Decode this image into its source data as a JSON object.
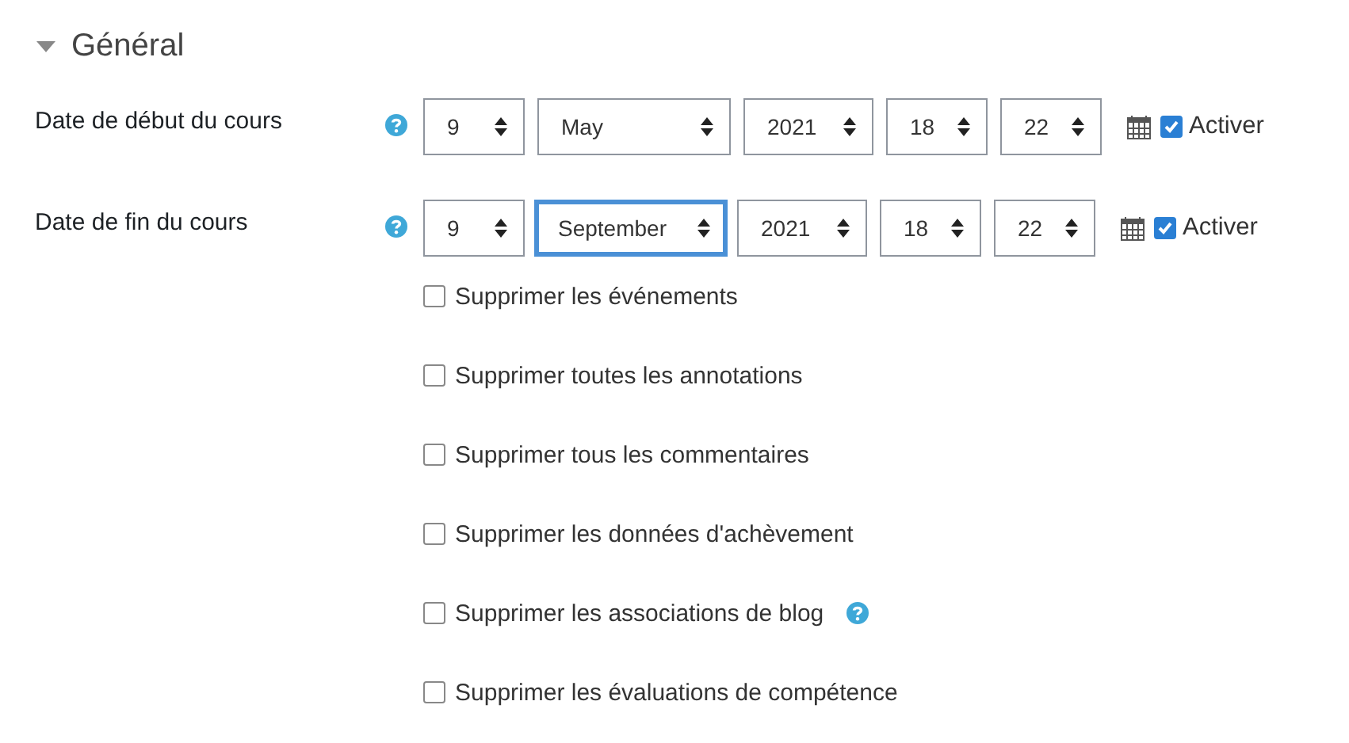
{
  "section": {
    "title": "Général",
    "expanded": true
  },
  "date_rows": [
    {
      "label": "Date de début du cours",
      "help": true,
      "fields": [
        {
          "value": "9",
          "focused": false
        },
        {
          "value": "May",
          "focused": false
        },
        {
          "value": "2021",
          "focused": false
        },
        {
          "value": "18",
          "focused": false
        },
        {
          "value": "22",
          "focused": false
        }
      ],
      "enable": {
        "label": "Activer",
        "checked": true
      }
    },
    {
      "label": "Date de fin du cours",
      "help": true,
      "fields": [
        {
          "value": "9",
          "focused": false
        },
        {
          "value": "September",
          "focused": true
        },
        {
          "value": "2021",
          "focused": false
        },
        {
          "value": "18",
          "focused": false
        },
        {
          "value": "22",
          "focused": false
        }
      ],
      "enable": {
        "label": "Activer",
        "checked": true
      }
    }
  ],
  "options": [
    {
      "label": "Supprimer les événements",
      "checked": false,
      "help": false
    },
    {
      "label": "Supprimer toutes les annotations",
      "checked": false,
      "help": false
    },
    {
      "label": "Supprimer tous les commentaires",
      "checked": false,
      "help": false
    },
    {
      "label": "Supprimer les données d'achèvement",
      "checked": false,
      "help": false
    },
    {
      "label": "Supprimer les associations de blog",
      "checked": false,
      "help": true
    },
    {
      "label": "Supprimer les évaluations de compétence",
      "checked": false,
      "help": false
    }
  ]
}
